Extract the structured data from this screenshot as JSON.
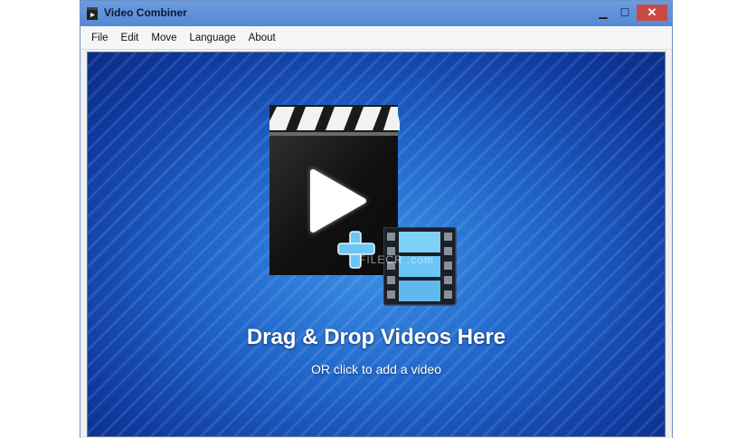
{
  "window": {
    "title": "Video Combiner",
    "controls": {
      "minimize": "▁",
      "maximize": "☐",
      "close": "✕"
    }
  },
  "menu": {
    "items": [
      {
        "label": "File"
      },
      {
        "label": "Edit"
      },
      {
        "label": "Move"
      },
      {
        "label": "Language"
      },
      {
        "label": "About"
      }
    ]
  },
  "dropzone": {
    "main_text": "Drag & Drop Videos Here",
    "sub_text": "OR click to add a video",
    "watermark": "FILECR .com",
    "icons": [
      "clapperboard-play-icon",
      "plus-icon",
      "film-strip-icon"
    ]
  },
  "colors": {
    "titlebar": "#5c8ed7",
    "close_button": "#c94a45",
    "dropzone_blue": "#1f62c8"
  }
}
